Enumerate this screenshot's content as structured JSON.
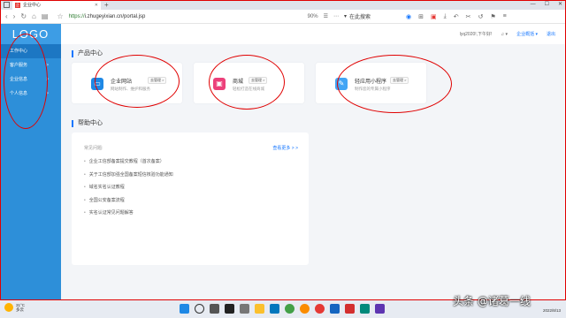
{
  "browser": {
    "tab_title": "企业中心",
    "url_scheme": "https://",
    "url_rest": "i.zhugeyixian.cn/portal.jsp",
    "zoom": "90%",
    "search_placeholder": "在此搜索"
  },
  "sidebar": {
    "logo": "LOGO",
    "items": [
      {
        "label": "工作中心",
        "chevron": ""
      },
      {
        "label": "客户服务",
        "chevron": ">"
      },
      {
        "label": "企业信息",
        "chevron": ">"
      },
      {
        "label": "个人信息",
        "chevron": ">"
      }
    ]
  },
  "header": {
    "greeting": "lyq2020!,下午好!",
    "user_menu": "企业概括 ▾",
    "logout": "退出"
  },
  "products": {
    "title": "产品中心",
    "cards": [
      {
        "name": "企业网站",
        "badge": "去管理 >",
        "desc": "网站制作、维护和服务",
        "icon_color": "#1e88e5",
        "icon": "▭"
      },
      {
        "name": "商城",
        "badge": "去管理 >",
        "desc": "轻松打造在线商城",
        "icon_color": "#ec407a",
        "icon": "▣"
      },
      {
        "name": "轻应用小程序",
        "badge": "去管理 >",
        "desc": "制作您的专属小程序",
        "icon_color": "#42a5f5",
        "icon": "✎"
      }
    ]
  },
  "help": {
    "title": "帮助中心",
    "faq_label": "常见问题:",
    "more_link": "查看更多 > >",
    "items": [
      "企业工信部备案提交教程（首次备案）",
      "关于工信部加强全国备案短信核验功能通知",
      "域名实名认证教程",
      "全国公安备案流程",
      "实名认证常见问题解答"
    ]
  },
  "taskbar": {
    "temp": "31°C",
    "weather": "多云",
    "date": "2022/8/13"
  },
  "watermark": "头条 @诸葛一线"
}
